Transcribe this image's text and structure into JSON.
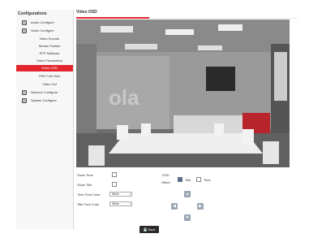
{
  "sidebar": {
    "title": "Configurations",
    "items": [
      {
        "label": "Audio Configure",
        "icon": "audio-icon"
      },
      {
        "label": "Video Configure",
        "icon": "video-icon"
      },
      {
        "label": "Video Encode"
      },
      {
        "label": "Stream Publish"
      },
      {
        "label": "RTP Multicast"
      },
      {
        "label": "Video Parameters"
      },
      {
        "label": "Video OSD",
        "active": true
      },
      {
        "label": "OSD Font Size"
      },
      {
        "label": "Video Out"
      },
      {
        "label": "Network Configure",
        "icon": "network-icon"
      },
      {
        "label": "System Configure",
        "icon": "system-icon"
      }
    ]
  },
  "main": {
    "title": "Video OSD"
  },
  "controls": {
    "show_time_label": "Show Time",
    "show_title_label": "Show Title",
    "time_font_color_label": "Time Font Color",
    "time_font_color_value": "White",
    "title_font_color_label": "Title Font Color",
    "title_font_color_value": "White",
    "osd_offset_label_1": "OSD",
    "osd_offset_label_2": "Offset",
    "offset_title_label": "Title",
    "offset_time_label": "Time",
    "save_label": "Save"
  },
  "colors": {
    "accent": "#e3262e",
    "button_dark": "#2a2a2a",
    "arrow_button": "#9aa6b4"
  }
}
